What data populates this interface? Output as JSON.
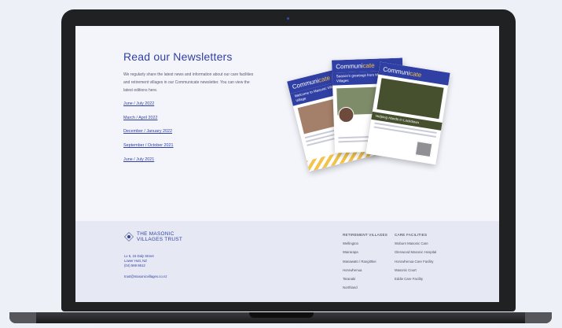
{
  "newsletters": {
    "title": "Read our Newsletters",
    "description": "We regularly share the latest news and information about our care facilities and retirement villages in our Communicate newsletter. You can view the latest editions here.",
    "links": [
      "June / July 2022",
      "March / April 2022",
      "December / January 2022",
      "September / October 2021",
      "June / July 2021"
    ]
  },
  "magazines": {
    "title_part1": "Communi",
    "title_part2": "cate",
    "left_caption": "Welcome to Masonic Villages Trust Village",
    "middle_caption": "Season's greetings from Masonic Villages",
    "right_caption": "Helping Hands in Lockdown"
  },
  "footer": {
    "logo_line1": "THE MASONIC",
    "logo_line2": "VILLAGES TRUST",
    "address_line1": "Lv 6, 15 Daly Street",
    "address_line2": "Lower Hutt, NZ",
    "phone": "(04) 569 8612",
    "email": "trust@masonicvillages.co.nz",
    "retirement_heading": "RETIREMENT VILLAGES",
    "retirement_items": [
      "Wellington",
      "Wairarapa",
      "Manawatū / Rangitīkei",
      "Horowhenua",
      "Taranaki",
      "Northland"
    ],
    "care_heading": "CARE FACILITIES",
    "care_items": [
      "Woburn Masonic Care",
      "Glenwood Masonic Hospital",
      "Horowhenua Care Facility",
      "Masonic Court",
      "Eddie Care Facility"
    ]
  },
  "colors": {
    "accent": "#2f3fa3",
    "background": "#eef0f7",
    "screen": "#f4f5fb",
    "footer": "#e6e9f3",
    "laptop_frame": "#202123",
    "highlight": "#f3c34a"
  },
  "icons": [
    "camera",
    "masonic-logo-icon"
  ]
}
